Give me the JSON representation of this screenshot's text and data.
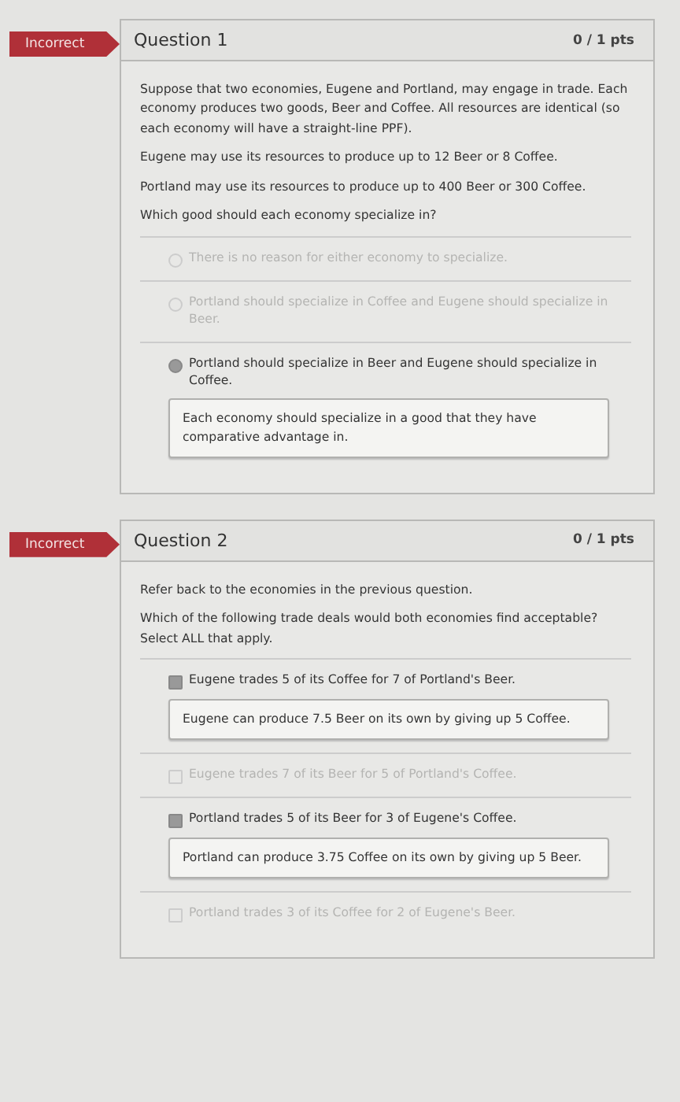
{
  "questions": [
    {
      "status": "Incorrect",
      "title": "Question 1",
      "points": "0 / 1 pts",
      "kind": "radio",
      "paragraphs": [
        "Suppose that two economies, Eugene and Portland, may engage in trade. Each economy produces two goods, Beer and Coffee. All resources are identical (so each economy will have a straight-line PPF).",
        "Eugene may use its resources to produce up to 12 Beer or 8 Coffee.",
        "Portland may use its resources to produce up to 400 Beer or 300 Coffee.",
        "Which good should each economy specialize in?"
      ],
      "answers": [
        {
          "text": "There is no reason for either economy to specialize.",
          "selected": false
        },
        {
          "text": "Portland should specialize in Coffee and Eugene should specialize in Beer.",
          "selected": false
        },
        {
          "text": "Portland should specialize in Beer and Eugene should specialize in Coffee.",
          "selected": true,
          "feedback": "Each economy should specialize in a good that they have comparative advantage in."
        }
      ]
    },
    {
      "status": "Incorrect",
      "title": "Question 2",
      "points": "0 / 1 pts",
      "kind": "checkbox",
      "paragraphs": [
        "Refer back to the economies in the previous question.",
        "Which of the following trade deals would both economies find acceptable? Select ALL that apply."
      ],
      "answers": [
        {
          "text": "Eugene trades 5 of its Coffee for 7 of Portland's Beer.",
          "selected": true,
          "feedback": "Eugene can produce 7.5 Beer on its own by giving up 5 Coffee."
        },
        {
          "text": "Eugene trades 7 of its Beer for 5 of Portland's Coffee.",
          "selected": false
        },
        {
          "text": "Portland trades 5 of its Beer for 3 of Eugene's Coffee.",
          "selected": true,
          "feedback": "Portland can produce 3.75 Coffee on its own by giving up 5 Beer."
        },
        {
          "text": "Portland trades 3 of its Coffee for 2 of Eugene's Beer.",
          "selected": false
        }
      ]
    }
  ]
}
